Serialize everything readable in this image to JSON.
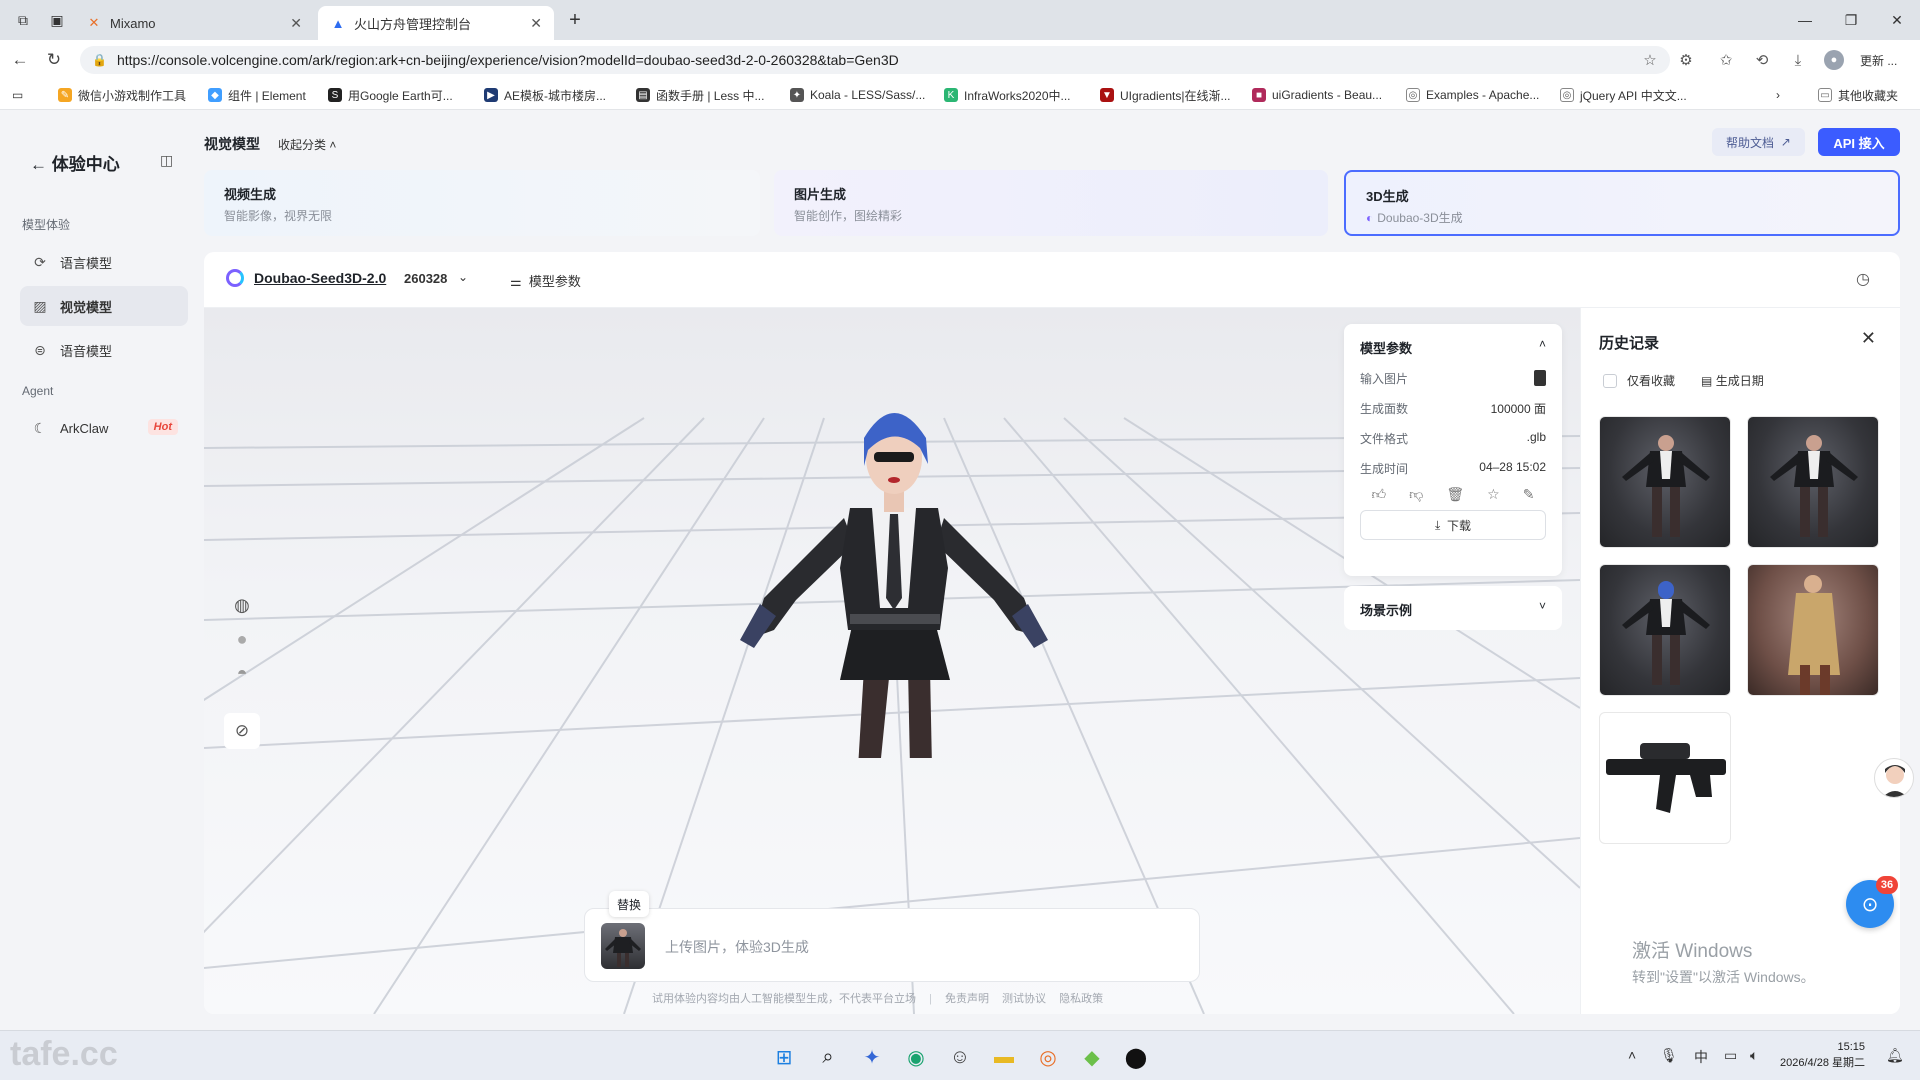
{
  "browser": {
    "tabs": [
      {
        "title": "Mixamo"
      },
      {
        "title": "火山方舟管理控制台"
      }
    ],
    "url": "https://console.volcengine.com/ark/region:ark+cn-beijing/experience/vision?modelId=doubao-seed3d-2-0-260328&tab=Gen3D",
    "update_label": "更新 ...",
    "bookmarks": [
      "微信小游戏制作工具",
      "组件 | Element",
      "用Google Earth可...",
      "AE模板-城市楼房...",
      "函数手册 | Less 中...",
      "Koala - LESS/Sass/...",
      "InfraWorks2020中...",
      "UIgradients|在线渐...",
      "uiGradients - Beau...",
      "Examples - Apache...",
      "jQuery API 中文文...",
      "其他收藏夹"
    ]
  },
  "sidebar": {
    "title": "体验中心",
    "group_model": "模型体验",
    "items": [
      {
        "label": "语言模型"
      },
      {
        "label": "视觉模型"
      },
      {
        "label": "语音模型"
      }
    ],
    "group_agent": "Agent",
    "agent_item": {
      "label": "ArkClaw",
      "badge": "Hot"
    }
  },
  "header": {
    "title": "视觉模型",
    "collapse": "收起分类",
    "help": "帮助文档",
    "api": "API 接入"
  },
  "categories": [
    {
      "title": "视频生成",
      "subtitle": "智能影像，视界无限"
    },
    {
      "title": "图片生成",
      "subtitle": "智能创作，图绘精彩"
    },
    {
      "title": "3D生成",
      "subtitle": "Doubao-3D生成"
    }
  ],
  "model": {
    "name": "Doubao-Seed3D-2.0",
    "version": "260328",
    "params_link": "模型参数"
  },
  "params_panel": {
    "title": "模型参数",
    "rows": [
      {
        "label": "输入图片",
        "value": ""
      },
      {
        "label": "生成面数",
        "value": "100000 面"
      },
      {
        "label": "文件格式",
        "value": ".glb"
      },
      {
        "label": "生成时间",
        "value": "04–28 15:02"
      }
    ],
    "download": "下载",
    "scene_title": "场景示例"
  },
  "upload": {
    "replace": "替换",
    "placeholder": "上传图片，体验3D生成"
  },
  "footer": {
    "disclaimer": "试用体验内容均由人工智能模型生成，不代表平台立场",
    "link1": "免责声明",
    "link2": "测试协议",
    "link3": "隐私政策"
  },
  "history": {
    "title": "历史记录",
    "only_fav": "仅看收藏",
    "gen_date": "生成日期"
  },
  "watermark": {
    "line1": "激活 Windows",
    "line2": "转到\"设置\"以激活 Windows。"
  },
  "float_badge": "36",
  "taskbar": {
    "site_mark": "tafe.cc",
    "time": "15:15",
    "date": "2026/4/28 星期二",
    "ime": "中"
  },
  "colors": {
    "accent": "#3b5cff",
    "active_border": "#4b6cff",
    "hot": "#e8473c"
  }
}
